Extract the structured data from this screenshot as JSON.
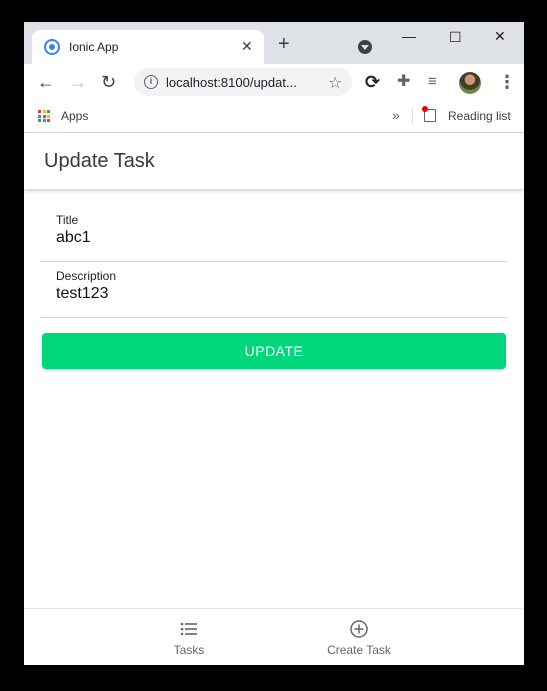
{
  "browser": {
    "tab_title": "Ionic App",
    "url": "localhost:8100/updat...",
    "bookmarks": {
      "apps_label": "Apps",
      "reading_list_label": "Reading list"
    }
  },
  "app": {
    "header_title": "Update Task",
    "form": {
      "title_label": "Title",
      "title_value": "abc1",
      "description_label": "Description",
      "description_value": "test123",
      "submit_label": "UPDATE"
    },
    "tabs": [
      {
        "label": "Tasks",
        "icon": "list-icon"
      },
      {
        "label": "Create Task",
        "icon": "add-circle-icon"
      }
    ]
  },
  "colors": {
    "primary_button": "#00d67a",
    "ionic_blue": "#3880ff"
  }
}
